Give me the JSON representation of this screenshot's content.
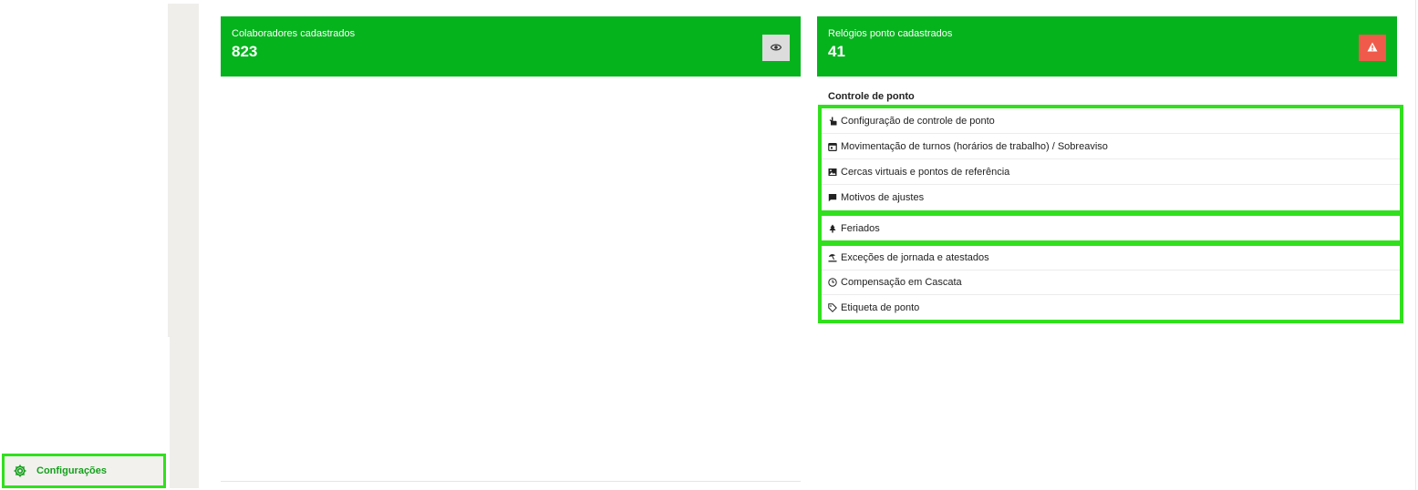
{
  "sidebar": {
    "config_label": "Configurações",
    "config_icon": "gear-icon"
  },
  "cards": [
    {
      "title": "Colaboradores cadastrados",
      "value": "823",
      "action_icon": "eye-icon"
    },
    {
      "title": "Relógios ponto cadastrados",
      "value": "41",
      "action_icon": "warning-icon"
    }
  ],
  "controle": {
    "title": "Controle de ponto",
    "items": [
      {
        "label": "Configuração de controle de ponto",
        "icon": "hand-pointer-icon"
      },
      {
        "label": "Movimentação de turnos (horários de trabalho) / Sobreaviso",
        "icon": "calendar-icon"
      },
      {
        "label": "Cercas virtuais e pontos de referência",
        "icon": "image-icon"
      },
      {
        "label": "Motivos de ajustes",
        "icon": "comment-icon"
      },
      {
        "label": "Feriados",
        "icon": "tree-icon"
      },
      {
        "label": "Exceções de jornada e atestados",
        "icon": "umbrella-beach-icon"
      },
      {
        "label": "Compensação em Cascata",
        "icon": "clock-icon"
      },
      {
        "label": "Etiqueta de ponto",
        "icon": "tag-icon"
      }
    ]
  },
  "colors": {
    "card_green": "#05b31d",
    "highlight_green": "#31e01d",
    "warning_red": "#ef5a4a",
    "config_text": "#14a01b"
  }
}
